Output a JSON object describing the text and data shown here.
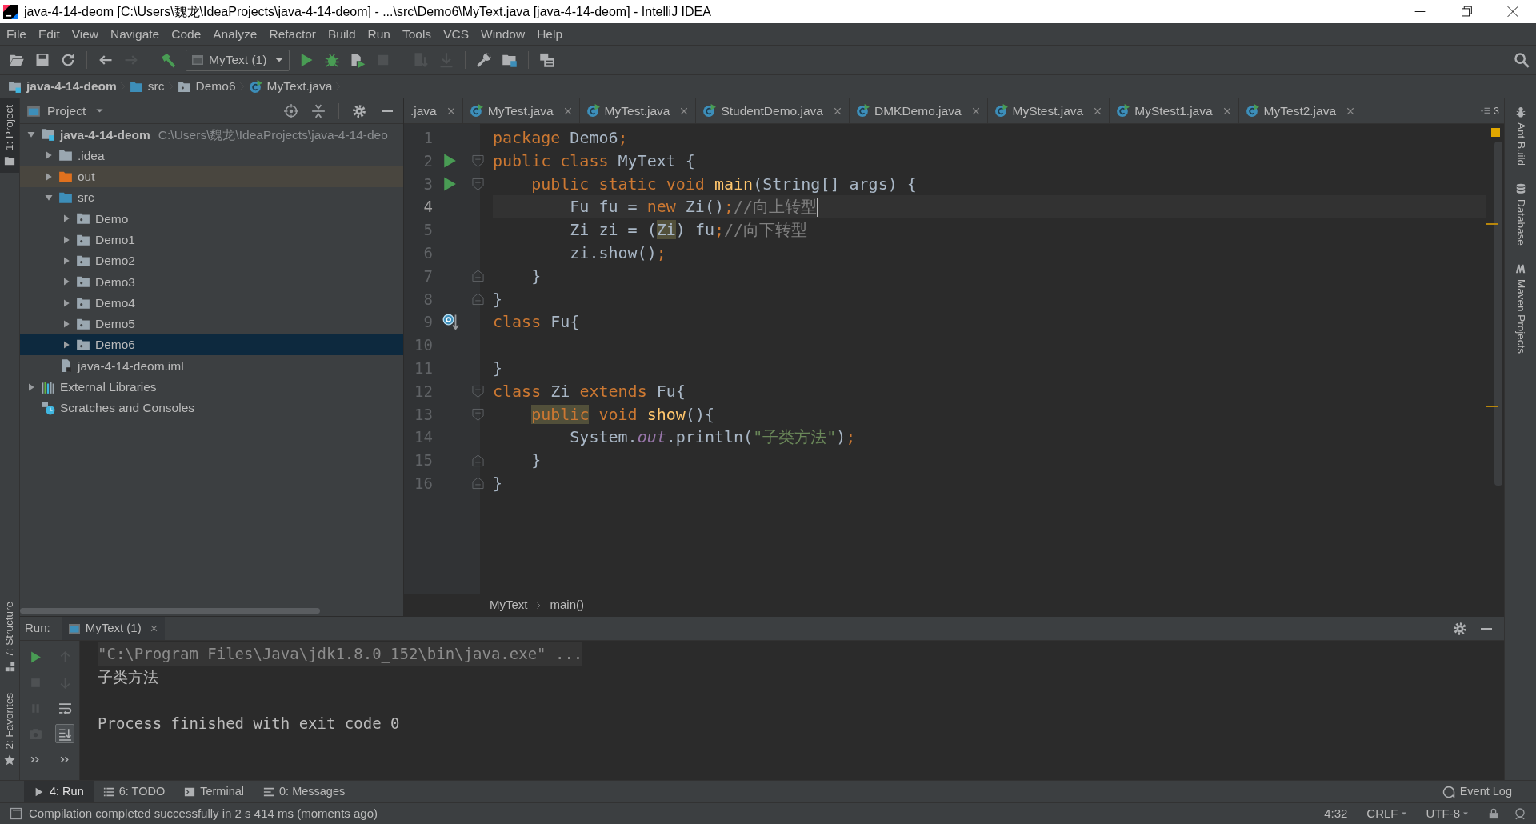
{
  "window": {
    "title": "java-4-14-deom [C:\\Users\\魏龙\\IdeaProjects\\java-4-14-deom] - ...\\src\\Demo6\\MyText.java [java-4-14-deom] - IntelliJ IDEA"
  },
  "menu": [
    "File",
    "Edit",
    "View",
    "Navigate",
    "Code",
    "Analyze",
    "Refactor",
    "Build",
    "Run",
    "Tools",
    "VCS",
    "Window",
    "Help"
  ],
  "toolbar": [
    {
      "kind": "open",
      "disabled": false
    },
    {
      "kind": "save",
      "disabled": false
    },
    {
      "kind": "sync",
      "disabled": false
    },
    {
      "kind": "separator"
    },
    {
      "kind": "back",
      "disabled": false
    },
    {
      "kind": "forward",
      "disabled": true
    },
    {
      "kind": "separator"
    },
    {
      "kind": "build",
      "disabled": false
    },
    {
      "kind": "run-config",
      "label": "MyText (1)"
    },
    {
      "kind": "run",
      "disabled": false
    },
    {
      "kind": "debug",
      "disabled": false
    },
    {
      "kind": "coverage",
      "disabled": false
    },
    {
      "kind": "stop",
      "disabled": true
    },
    {
      "kind": "separator"
    },
    {
      "kind": "vcs-update",
      "disabled": true
    },
    {
      "kind": "vcs-commit",
      "disabled": true
    },
    {
      "kind": "separator"
    },
    {
      "kind": "wrench",
      "disabled": false
    },
    {
      "kind": "project-structure",
      "disabled": false
    },
    {
      "kind": "separator"
    },
    {
      "kind": "sdk",
      "disabled": false
    }
  ],
  "navigation": [
    {
      "label": "java-4-14-deom",
      "kind": "module"
    },
    {
      "label": "src",
      "kind": "source-folder"
    },
    {
      "label": "Demo6",
      "kind": "package"
    },
    {
      "label": "MyText.java",
      "kind": "class"
    }
  ],
  "left_strip": {
    "top": [
      {
        "label": "1: Project",
        "selected": true,
        "kind": "project"
      }
    ],
    "bottom": [
      {
        "label": "7: Structure",
        "selected": false,
        "kind": "structure"
      },
      {
        "label": "2: Favorites",
        "selected": false,
        "kind": "favorites"
      }
    ]
  },
  "right_strip": [
    {
      "label": "Ant Build",
      "kind": "ant"
    },
    {
      "label": "Database",
      "kind": "database"
    },
    {
      "label": "Maven Projects",
      "kind": "maven"
    }
  ],
  "project_panel": {
    "title": "Project",
    "tree": [
      {
        "label": "java-4-14-deom",
        "path": "C:\\Users\\魏龙\\IdeaProjects\\java-4-14-deo",
        "kind": "module",
        "expanded": true,
        "selected": false,
        "children": [
          {
            "label": ".idea",
            "kind": "folder",
            "expanded": false,
            "selected": false
          },
          {
            "label": "out",
            "kind": "excluded-folder",
            "expanded": false,
            "selected": false
          },
          {
            "label": "src",
            "kind": "source-folder",
            "expanded": true,
            "selected": false,
            "children": [
              {
                "label": "Demo",
                "kind": "package",
                "expanded": false,
                "selected": false
              },
              {
                "label": "Demo1",
                "kind": "package",
                "expanded": false,
                "selected": false
              },
              {
                "label": "Demo2",
                "kind": "package",
                "expanded": false,
                "selected": false
              },
              {
                "label": "Demo3",
                "kind": "package",
                "expanded": false,
                "selected": false
              },
              {
                "label": "Demo4",
                "kind": "package",
                "expanded": false,
                "selected": false
              },
              {
                "label": "Demo5",
                "kind": "package",
                "expanded": false,
                "selected": false
              },
              {
                "label": "Demo6",
                "kind": "package",
                "expanded": false,
                "selected": true
              }
            ]
          },
          {
            "label": "java-4-14-deom.iml",
            "kind": "iml-file",
            "selected": false
          }
        ]
      },
      {
        "label": "External Libraries",
        "kind": "libraries",
        "expanded": false,
        "selected": false
      },
      {
        "label": "Scratches and Consoles",
        "kind": "scratches",
        "selected": false
      }
    ]
  },
  "editor": {
    "tabs": [
      {
        "label": ".java",
        "kind": "partial",
        "selected": false
      },
      {
        "label": "MyTest.java",
        "kind": "class",
        "selected": false
      },
      {
        "label": "MyTest.java",
        "kind": "class",
        "selected": false
      },
      {
        "label": "StudentDemo.java",
        "kind": "class",
        "selected": false
      },
      {
        "label": "DMKDemo.java",
        "kind": "class",
        "selected": false
      },
      {
        "label": "MyStest.java",
        "kind": "class",
        "selected": false
      },
      {
        "label": "MyStest1.java",
        "kind": "class",
        "selected": false
      },
      {
        "label": "MyTest2.java",
        "kind": "class",
        "selected": false
      }
    ],
    "hidden_tabs_count": "3",
    "lines": [
      {
        "number": "1",
        "current": false,
        "run_marker": false,
        "override_marker": false,
        "fold_start": false,
        "fold_end": false,
        "tokens": [
          {
            "text": "package",
            "kind": "keyword"
          },
          {
            "text": " Demo6",
            "kind": "plain"
          },
          {
            "text": ";",
            "kind": "punct"
          }
        ]
      },
      {
        "number": "2",
        "current": false,
        "run_marker": true,
        "override_marker": false,
        "fold_start": true,
        "fold_end": false,
        "tokens": [
          {
            "text": "public class",
            "kind": "keyword"
          },
          {
            "text": " MyText {",
            "kind": "plain"
          }
        ]
      },
      {
        "number": "3",
        "current": false,
        "run_marker": true,
        "override_marker": false,
        "fold_start": true,
        "fold_end": false,
        "tokens": [
          {
            "text": "    public static void",
            "kind": "keyword"
          },
          {
            "text": " main",
            "kind": "method"
          },
          {
            "text": "(String[] args) {",
            "kind": "plain"
          }
        ]
      },
      {
        "number": "4",
        "current": true,
        "run_marker": false,
        "override_marker": false,
        "fold_start": false,
        "fold_end": false,
        "tokens": [
          {
            "text": "        Fu fu = ",
            "kind": "plain"
          },
          {
            "text": "new",
            "kind": "keyword"
          },
          {
            "text": " Zi()",
            "kind": "plain"
          },
          {
            "text": ";",
            "kind": "punct"
          },
          {
            "text": "//向上转型",
            "kind": "comment"
          }
        ]
      },
      {
        "number": "5",
        "current": false,
        "run_marker": false,
        "override_marker": false,
        "fold_start": false,
        "fold_end": false,
        "tokens": [
          {
            "text": "        Zi zi = (",
            "kind": "plain"
          },
          {
            "text": "Zi",
            "kind": "plain-highlight"
          },
          {
            "text": ") fu",
            "kind": "plain"
          },
          {
            "text": ";",
            "kind": "punct"
          },
          {
            "text": "//向下转型",
            "kind": "comment"
          }
        ]
      },
      {
        "number": "6",
        "current": false,
        "run_marker": false,
        "override_marker": false,
        "fold_start": false,
        "fold_end": false,
        "tokens": [
          {
            "text": "        zi.show()",
            "kind": "plain"
          },
          {
            "text": ";",
            "kind": "punct"
          }
        ]
      },
      {
        "number": "7",
        "current": false,
        "run_marker": false,
        "override_marker": false,
        "fold_start": false,
        "fold_end": true,
        "tokens": [
          {
            "text": "    }",
            "kind": "plain"
          }
        ]
      },
      {
        "number": "8",
        "current": false,
        "run_marker": false,
        "override_marker": false,
        "fold_start": false,
        "fold_end": true,
        "tokens": [
          {
            "text": "}",
            "kind": "plain"
          }
        ]
      },
      {
        "number": "9",
        "current": false,
        "run_marker": false,
        "override_marker": true,
        "fold_start": false,
        "fold_end": false,
        "tokens": [
          {
            "text": "class",
            "kind": "keyword"
          },
          {
            "text": " Fu{",
            "kind": "plain"
          }
        ]
      },
      {
        "number": "10",
        "current": false,
        "run_marker": false,
        "override_marker": false,
        "fold_start": false,
        "fold_end": false
      },
      {
        "number": "11",
        "current": false,
        "run_marker": false,
        "override_marker": false,
        "fold_start": false,
        "fold_end": false,
        "tokens": [
          {
            "text": "}",
            "kind": "plain"
          }
        ]
      },
      {
        "number": "12",
        "current": false,
        "run_marker": false,
        "override_marker": false,
        "fold_start": true,
        "fold_end": false,
        "tokens": [
          {
            "text": "class",
            "kind": "keyword"
          },
          {
            "text": " Zi ",
            "kind": "plain"
          },
          {
            "text": "extends",
            "kind": "keyword"
          },
          {
            "text": " Fu{",
            "kind": "plain"
          }
        ]
      },
      {
        "number": "13",
        "current": false,
        "run_marker": false,
        "override_marker": false,
        "fold_start": true,
        "fold_end": false,
        "tokens": [
          {
            "text": "    public",
            "kind": "keyword-highlight"
          },
          {
            "text": " void",
            "kind": "keyword"
          },
          {
            "text": " show",
            "kind": "method"
          },
          {
            "text": "(){",
            "kind": "plain"
          }
        ]
      },
      {
        "number": "14",
        "current": false,
        "run_marker": false,
        "override_marker": false,
        "fold_start": false,
        "fold_end": false,
        "tokens": [
          {
            "text": "        System.",
            "kind": "plain"
          },
          {
            "text": "out",
            "kind": "field"
          },
          {
            "text": ".println(",
            "kind": "plain"
          },
          {
            "text": "\"子类方法\"",
            "kind": "string"
          },
          {
            "text": ")",
            "kind": "plain"
          },
          {
            "text": ";",
            "kind": "punct"
          }
        ]
      },
      {
        "number": "15",
        "current": false,
        "run_marker": false,
        "override_marker": false,
        "fold_start": false,
        "fold_end": true,
        "tokens": [
          {
            "text": "    }",
            "kind": "plain"
          }
        ]
      },
      {
        "number": "16",
        "current": false,
        "run_marker": false,
        "override_marker": false,
        "fold_start": false,
        "fold_end": true,
        "tokens": [
          {
            "text": "}",
            "kind": "plain"
          }
        ]
      }
    ],
    "breadcrumb": [
      "MyText",
      "main()"
    ]
  },
  "run_panel": {
    "label": "Run:",
    "tab": "MyText (1)",
    "tools_left": [
      {
        "kind": "rerun",
        "disabled": false
      },
      {
        "kind": "stop",
        "disabled": true
      },
      {
        "kind": "pause",
        "disabled": true
      },
      {
        "kind": "dump",
        "disabled": true
      },
      {
        "kind": "more",
        "disabled": false
      }
    ],
    "tools_right": [
      {
        "kind": "up",
        "disabled": true,
        "toggled": false
      },
      {
        "kind": "down",
        "disabled": true,
        "toggled": false
      },
      {
        "kind": "soft-wrap",
        "disabled": false,
        "toggled": false
      },
      {
        "kind": "scroll-to-end",
        "disabled": false,
        "toggled": true
      },
      {
        "kind": "more",
        "disabled": false,
        "toggled": false
      }
    ],
    "output": [
      {
        "text": "\"C:\\Program Files\\Java\\jdk1.8.0_152\\bin\\java.exe\" ...",
        "kind": "command"
      },
      {
        "text": "子类方法",
        "kind": "stdout"
      },
      {
        "text": "Process finished with exit code 0",
        "kind": "exit"
      }
    ]
  },
  "tool_tabs": [
    {
      "label": "4: Run",
      "kind": "run",
      "selected": true
    },
    {
      "label": "6: TODO",
      "kind": "todo",
      "selected": false
    },
    {
      "label": "Terminal",
      "kind": "terminal",
      "selected": false
    },
    {
      "label": "0: Messages",
      "kind": "messages",
      "selected": false
    }
  ],
  "event_log": "Event Log",
  "status_bar": {
    "message": "Compilation completed successfully in 2 s 414 ms (moments ago)",
    "position": "4:32",
    "line_separator": "CRLF",
    "encoding": "UTF-8"
  }
}
